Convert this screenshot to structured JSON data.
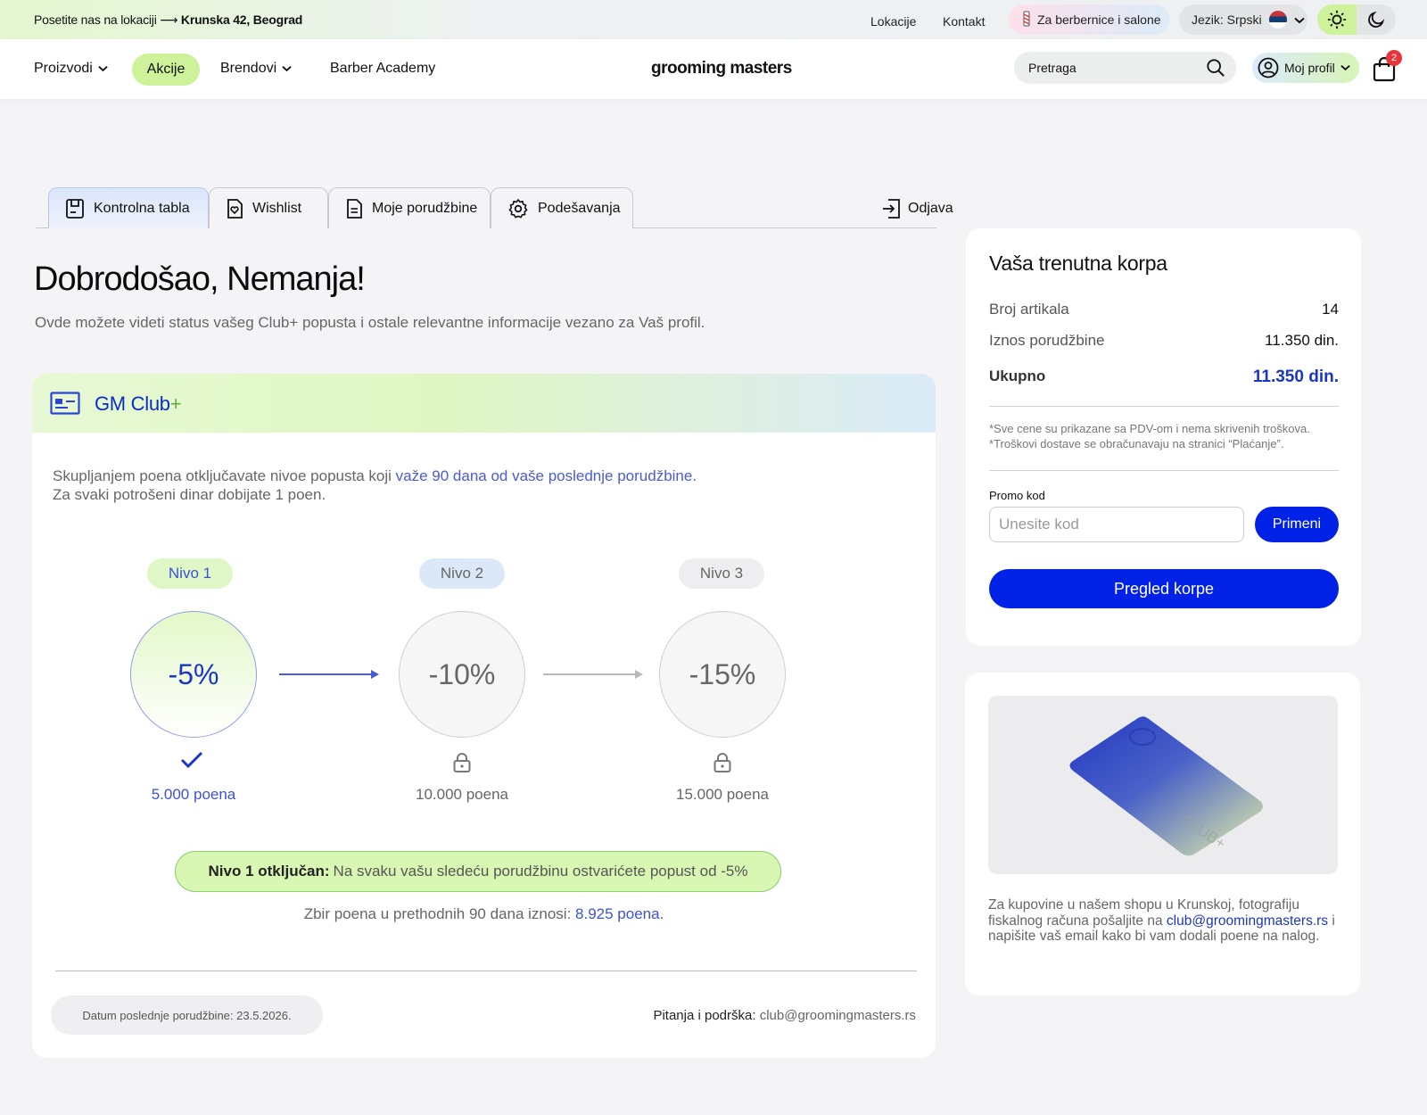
{
  "topbar": {
    "promo_prefix": "Posetite nas na lokaciji",
    "promo_arrow": "⟶",
    "promo_address": "Krunska 42, Beograd",
    "links": [
      "Lokacije",
      "Kontakt"
    ],
    "b2b_label": "Za berbernice i salone",
    "language_label": "Jezik: Srpski"
  },
  "nav": {
    "proizvodi": "Proizvodi",
    "akcije": "Akcije",
    "brendovi": "Brendovi",
    "academy": "Barber Academy",
    "logo": "grooming masters",
    "search_placeholder": "Pretraga",
    "profile_label": "Moj profil",
    "cart_count": "2"
  },
  "tabs": [
    {
      "label": "Kontrolna tabla",
      "active": true
    },
    {
      "label": "Wishlist"
    },
    {
      "label": "Moje porudžbine"
    },
    {
      "label": "Podešavanja"
    }
  ],
  "logout_label": "Odjava",
  "welcome": {
    "title": "Dobrodošao, Nemanja!",
    "subtitle": "Ovde možete videti status vašeg Club+ popusta i ostale relevantne informacije vezano za Vaš profil."
  },
  "club": {
    "title_main": "GM Club",
    "title_plus": "+",
    "desc_line1_pre": "Skupljanjem poena otključavate nivoe popusta koji ",
    "desc_line1_hl": "važe 90 dana od vaše poslednje porudžbine",
    "desc_line1_post": ".",
    "desc_line2": "Za svaki potrošeni dinar dobijate 1 poen.",
    "levels": [
      {
        "name": "Nivo 1",
        "discount": "-5%",
        "points": "5.000 poena",
        "status": "unlocked"
      },
      {
        "name": "Nivo 2",
        "discount": "-10%",
        "points": "10.000 poena",
        "status": "locked"
      },
      {
        "name": "Nivo 3",
        "discount": "-15%",
        "points": "15.000 poena",
        "status": "locked"
      }
    ],
    "unlock_bold": "Nivo 1 otključan:",
    "unlock_text": "Na svaku vašu sledeću porudžbinu ostvarićete popust od -5%",
    "sum_prefix": "Zbir poena u prethodnih 90 dana iznosi: ",
    "sum_value": "8.925 poena.",
    "last_order": "Datum poslednje porudžbine: 23.5.2026.",
    "support_label": "Pitanja i podrška:",
    "support_email": "club@groomingmasters.rs"
  },
  "cart": {
    "title": "Vaša trenutna korpa",
    "items_label": "Broj artikala",
    "items_value": "14",
    "amount_label": "Iznos porudžbine",
    "amount_value": "11.350 din.",
    "total_label": "Ukupno",
    "total_value": "11.350 din.",
    "note1": "*Sve cene su prikazane sa PDV-om i nema skrivenih troškova.",
    "note2": "*Troškovi dostave se obračunavaju na stranici “Plaćanje”.",
    "promo_label": "Promo kod",
    "promo_placeholder": "Unesite kod",
    "apply_label": "Primeni",
    "view_label": "Pregled korpe"
  },
  "info": {
    "card_text": "CLUB+",
    "text_pre": "Za kupovine u našem shopu u Krunskoj, fotografiju fiskalnog računa pošaljite na ",
    "email": "club@groomingmasters.rs",
    "text_post": " i napišite vaš email kako bi vam dodali poene na nalog."
  },
  "colors": {
    "accent_blue": "#0021e6",
    "accent_green": "#cdf29a",
    "badge_red": "#e8343a"
  }
}
